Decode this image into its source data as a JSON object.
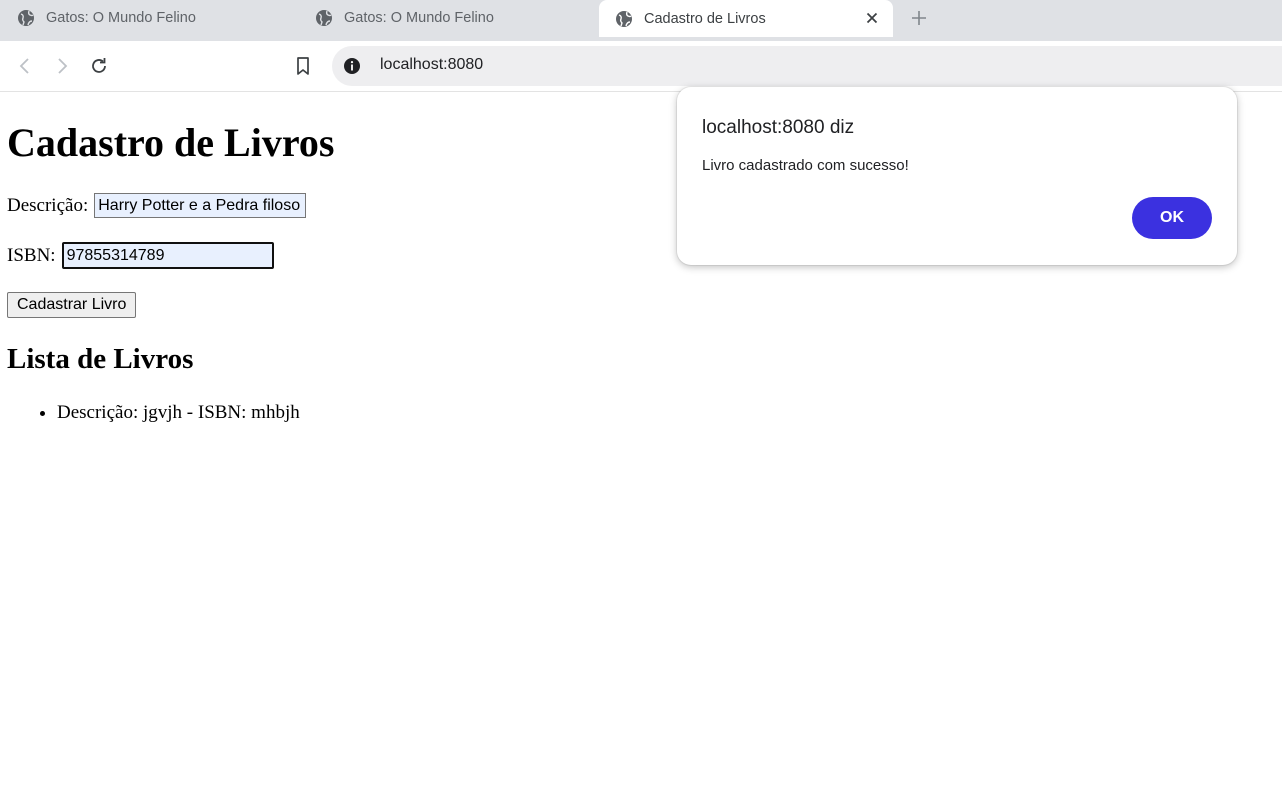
{
  "browser": {
    "tabs": [
      {
        "title": "Gatos: O Mundo Felino",
        "icon": "globe-icon",
        "active": false
      },
      {
        "title": "Gatos: O Mundo Felino",
        "icon": "globe-icon",
        "active": false
      },
      {
        "title": "Cadastro de Livros",
        "icon": "globe-icon",
        "active": true
      }
    ],
    "url": "localhost:8080"
  },
  "page": {
    "title": "Cadastro de Livros",
    "form": {
      "description_label": "Descrição:",
      "description_value": "Harry Potter e a Pedra filoso",
      "isbn_label": "ISBN:",
      "isbn_value": "97855314789",
      "submit_label": "Cadastrar Livro"
    },
    "list_title": "Lista de Livros",
    "books": [
      "Descrição: jgvjh - ISBN: mhbjh"
    ]
  },
  "dialog": {
    "title": "localhost:8080 diz",
    "message": "Livro cadastrado com sucesso!",
    "ok_label": "OK",
    "ok_color": "#3b31e0"
  }
}
